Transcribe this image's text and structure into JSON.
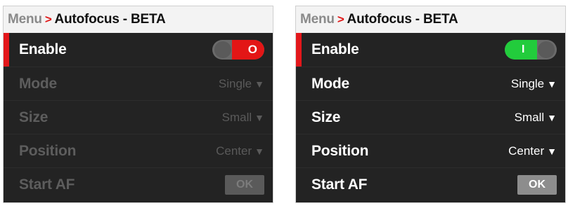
{
  "left_panel": {
    "breadcrumb": {
      "root": "Menu",
      "separator": ">",
      "page": "Autofocus - BETA"
    },
    "enable": {
      "label": "Enable",
      "toggle_state": "off",
      "toggle_glyph": "O",
      "toggle_color": "#e31616"
    },
    "mode": {
      "label": "Mode",
      "value": "Single",
      "chevron": "▼"
    },
    "size": {
      "label": "Size",
      "value": "Small",
      "chevron": "▼"
    },
    "position": {
      "label": "Position",
      "value": "Center",
      "chevron": "▼"
    },
    "start_af": {
      "label": "Start AF",
      "button_label": "OK"
    }
  },
  "right_panel": {
    "breadcrumb": {
      "root": "Menu",
      "separator": ">",
      "page": "Autofocus - BETA"
    },
    "enable": {
      "label": "Enable",
      "toggle_state": "on",
      "toggle_glyph": "I",
      "toggle_color": "#22cc3c"
    },
    "mode": {
      "label": "Mode",
      "value": "Single",
      "chevron": "▼"
    },
    "size": {
      "label": "Size",
      "value": "Small",
      "chevron": "▼"
    },
    "position": {
      "label": "Position",
      "value": "Center",
      "chevron": "▼"
    },
    "start_af": {
      "label": "Start AF",
      "button_label": "OK"
    }
  },
  "colors": {
    "accent_red": "#e3171b",
    "panel_bg": "#232323",
    "header_bg": "#f3f3f3"
  }
}
